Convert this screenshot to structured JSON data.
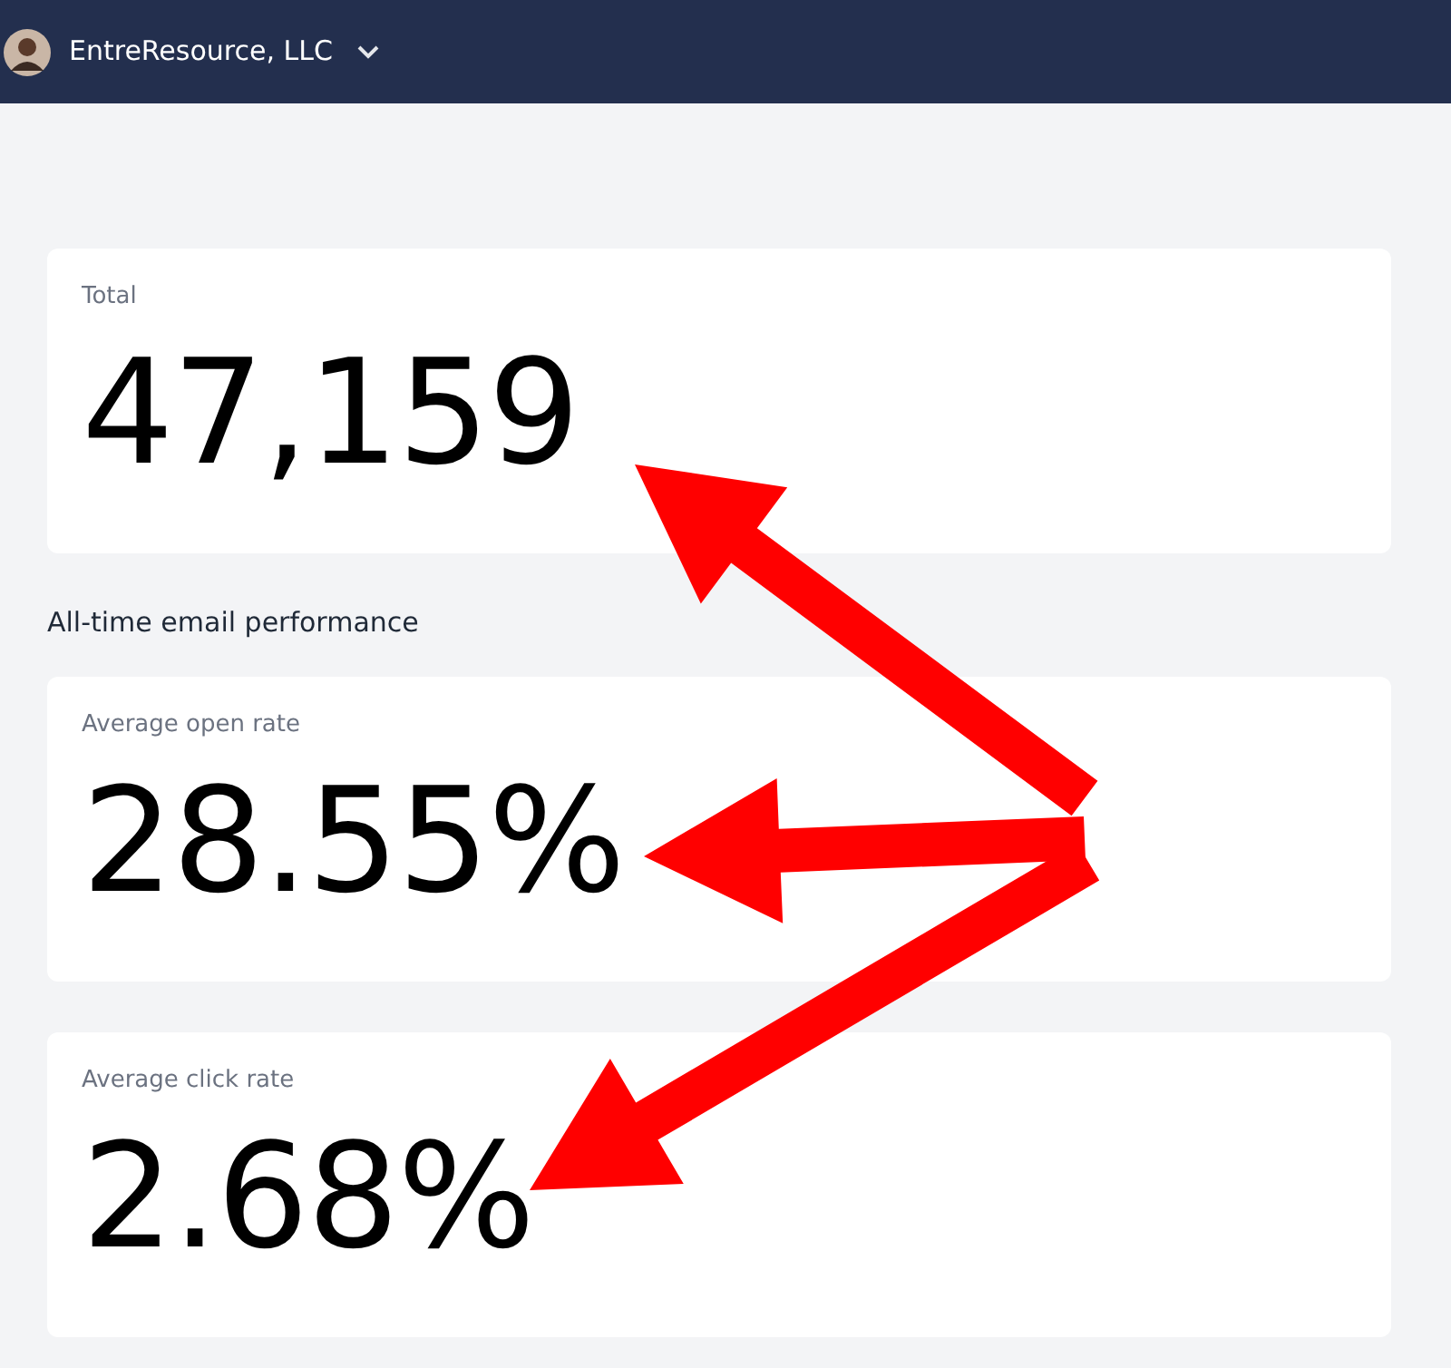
{
  "header": {
    "account_name": "EntreResource, LLC"
  },
  "total_card": {
    "label": "Total",
    "value": "47,159"
  },
  "section_title": "All-time email performance",
  "stat_cards": [
    {
      "label": "Average open rate",
      "value": "28.55%"
    },
    {
      "label": "Average click rate",
      "value": "2.68%"
    }
  ]
}
